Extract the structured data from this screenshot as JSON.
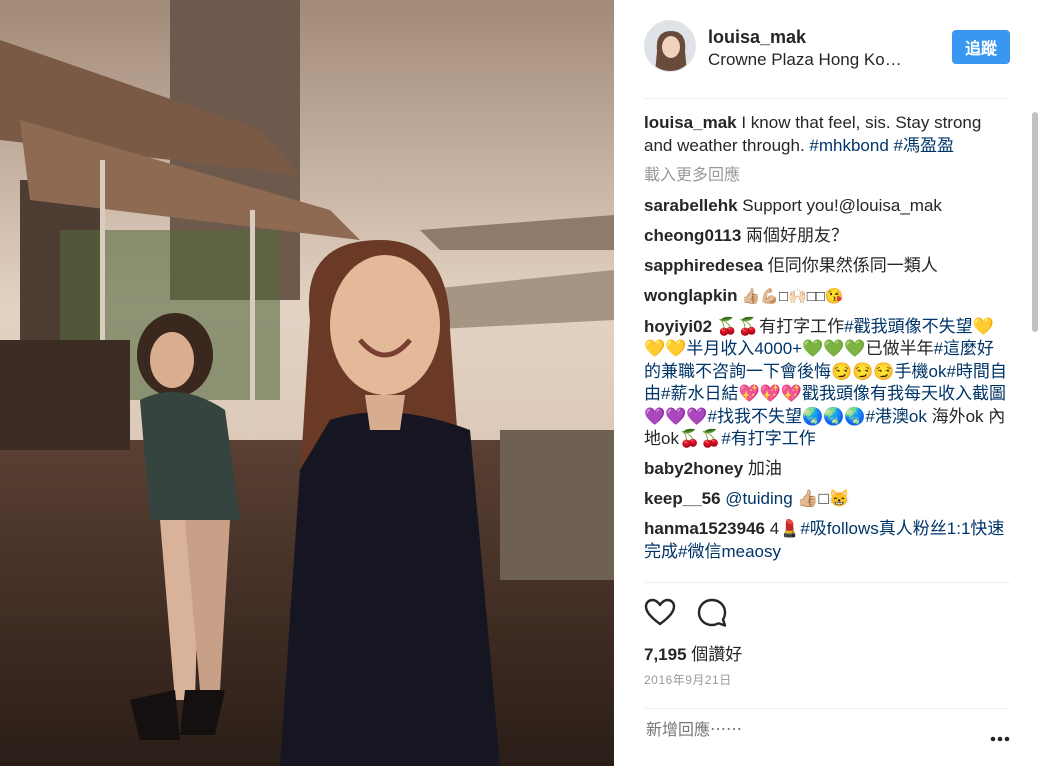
{
  "post": {
    "username": "louisa_mak",
    "location": "Crowne Plaza Hong Ko…",
    "follow_label": "追蹤",
    "caption": {
      "username": "louisa_mak",
      "text": " I know that feel, sis. Stay strong and weather through. ",
      "tag1": "#mhkbond",
      "tag2": "#馮盈盈"
    },
    "load_more_label": "載入更多回應",
    "likes_count": "7,195",
    "likes_label": " 個讚好",
    "date": "2016年9月21日",
    "add_comment_placeholder": "新增回應⋯⋯"
  },
  "comments": [
    {
      "user": "sarabellehk",
      "text": " Support you!@louisa_mak"
    },
    {
      "user": "cheong0113",
      "text": " 兩個好朋友？"
    },
    {
      "user": "sapphiredesea",
      "text": " 佢同你果然係同一類人"
    },
    {
      "user": "wonglapkin",
      "text": " 👍🏼💪🏼□🙌🏻□□😘"
    },
    {
      "user": "hoyiyi02",
      "text_a": " 🍒🍒有打字工作",
      "tag_a": "#戳我頭像不失望💛💛💛半月收入4000+💚💚💚",
      "text_b": "已做半年",
      "tag_b": "#這麼好的兼職不咨詢一下會後悔😏😏😏手機ok#時間自由#薪水日結💖💖💖戳我頭像有我每天收入截圖💜💜💜#找我不失望🌏🌏🌏#港澳ok",
      "text_c": " 海外ok 內地ok",
      "text_d": "🍒🍒",
      "tag_d": "#有打字工作"
    },
    {
      "user": "baby2honey",
      "text": " 加油"
    },
    {
      "user": "keep__56",
      "mention": " @tuiding",
      "text": " 👍🏼□😸"
    },
    {
      "user": "hanma1523946",
      "text_a": " 4💄",
      "tag_a": "#吸follows真人粉丝1:1快速完成#微信meaosy"
    }
  ],
  "colors": {
    "link": "#003569",
    "follow": "#3897f0",
    "muted": "#999999"
  }
}
